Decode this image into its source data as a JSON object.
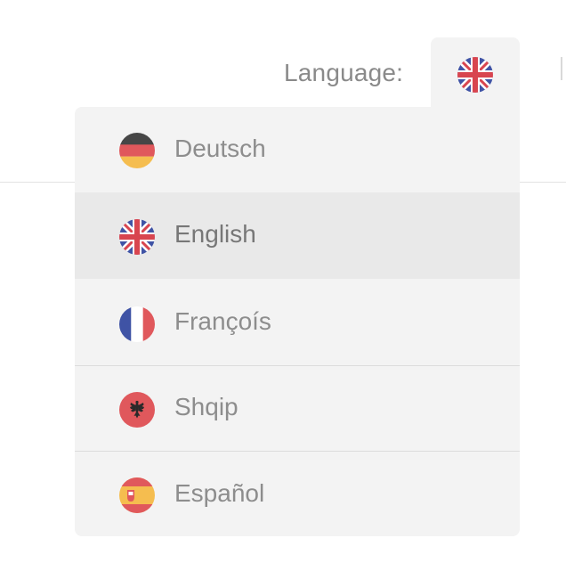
{
  "header": {
    "language_label": "Language:",
    "current_language_icon": "uk-flag-icon"
  },
  "dropdown": {
    "options": [
      {
        "label": "Deutsch",
        "icon": "germany-flag-icon",
        "selected": false
      },
      {
        "label": "English",
        "icon": "uk-flag-icon",
        "selected": true
      },
      {
        "label": "Françoís",
        "icon": "france-flag-icon",
        "selected": false
      },
      {
        "label": "Shqip",
        "icon": "albania-flag-icon",
        "selected": false
      },
      {
        "label": "Español",
        "icon": "spain-flag-icon",
        "selected": false
      }
    ]
  },
  "colors": {
    "panel_background": "#f3f3f3",
    "selected_background": "#e9e9e9",
    "text": "#8d8d8d",
    "divider": "#dcdcdc"
  }
}
